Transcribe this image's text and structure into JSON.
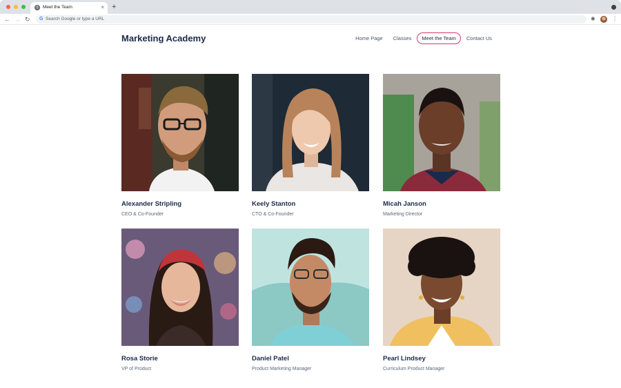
{
  "browser": {
    "tab_title": "Meet the Team",
    "tab_close": "×",
    "new_tab": "+",
    "address_placeholder": "Search Google or type a URL",
    "google_glyph": "G",
    "back_glyph": "←",
    "forward_glyph": "→",
    "reload_glyph": "↻",
    "extensions_glyph": "✱",
    "menu_glyph": "⋮"
  },
  "site": {
    "brand": "Marketing Academy",
    "nav": [
      {
        "label": "Home Page",
        "active": false
      },
      {
        "label": "Classes",
        "active": false
      },
      {
        "label": "Meet the Team",
        "active": true
      },
      {
        "label": "Contact Us",
        "active": false
      }
    ],
    "accent_color": "#d63a6b"
  },
  "team": [
    {
      "name": "Alexander Stripling",
      "role": "CEO & Co-Founder"
    },
    {
      "name": "Keely Stanton",
      "role": "CTO & Co-Founder"
    },
    {
      "name": "Micah Janson",
      "role": "Marketing Director"
    },
    {
      "name": "Rosa Storie",
      "role": "VP of Product"
    },
    {
      "name": "Daniel Patel",
      "role": "Product Marketing Manager"
    },
    {
      "name": "Pearl Lindsey",
      "role": "Curriculum Product Manager"
    }
  ]
}
